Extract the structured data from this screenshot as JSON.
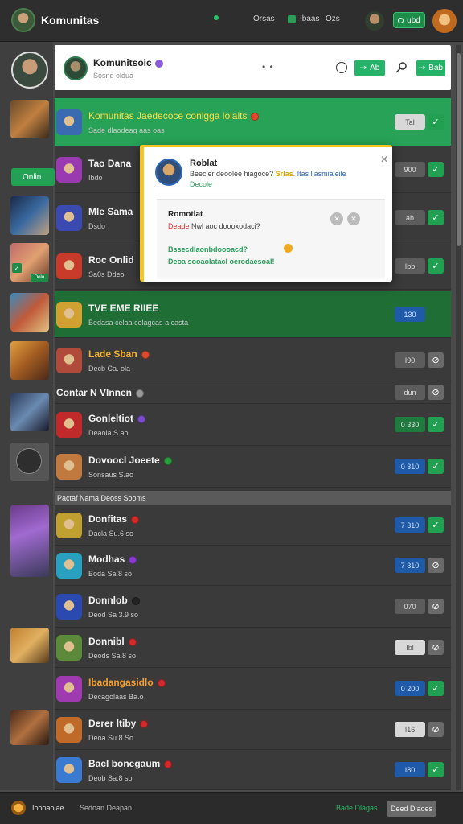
{
  "topbar": {
    "title": "Komunitas",
    "link1": "Orsas",
    "link2": "Ibaas",
    "link3": "Ozs",
    "pill_label": "ubd"
  },
  "rail": {
    "online_label": "Onlin",
    "badge1": "✓",
    "badge2": "Dolo"
  },
  "chat_header": {
    "name": "Komunitsoic",
    "subtitle": "Sosnd oldua",
    "btn1_label": "Ab",
    "btn2_label": "Bab"
  },
  "rows": [
    {
      "title": "Komunitas Jaedecoce conlgga lolalts",
      "subtitle": "Sade dlaodeag aas oas",
      "count": "Tal",
      "check_color": "green",
      "count_style": "light",
      "highlight": "green",
      "dot": "#e04a2a",
      "icon_color": "#3a6ab0"
    },
    {
      "title": "Tao Dana",
      "subtitle": "Ibdo",
      "count": "900",
      "check_color": "green",
      "count_style": "gray",
      "highlight": "",
      "dot": "",
      "icon_color": "#9a3ab0"
    },
    {
      "title": "Mle Sama",
      "subtitle": "Dsdo",
      "count": "ab",
      "check_color": "green",
      "count_style": "gray",
      "highlight": "",
      "dot": "",
      "icon_color": "#3a4ab0"
    },
    {
      "title": "Roc Onlid",
      "subtitle": "Sa0s Ddeo",
      "count": "Ibb",
      "check_color": "green",
      "count_style": "gray",
      "highlight": "",
      "dot": "",
      "icon_color": "#c83a2a"
    },
    {
      "title": "TVE EME RIIEE",
      "subtitle": "Bedasa celaa celagcas a casta",
      "count": "130",
      "check_color": "",
      "count_style": "blue",
      "highlight": "darkgreen",
      "dot": "",
      "icon_color": "#d0a030"
    },
    {
      "title": "Lade Sban",
      "subtitle": "Decb Ca. ola",
      "count": "I90",
      "check_color": "gray",
      "count_style": "gray",
      "highlight": "",
      "dot": "#e04a2a",
      "icon_color": "#b04a3a",
      "title_color": "#f0b030"
    },
    {
      "title": "Contar N Vlnnen",
      "subtitle": "",
      "count": "dun",
      "check_color": "gray",
      "count_style": "gray",
      "highlight": "",
      "dot": "#999",
      "icon_color": ""
    },
    {
      "title": "Gonleltiot",
      "subtitle": "Deaola S.ao",
      "count": "0 330",
      "check_color": "green",
      "count_style": "green",
      "highlight": "",
      "dot": "#7a4ad0",
      "icon_color": "#c02a2a"
    },
    {
      "title": "Dovoocl Joeete",
      "subtitle": "Sonsaus S.ao",
      "count": "0 310",
      "check_color": "green",
      "count_style": "blue",
      "highlight": "",
      "dot": "#2aa040",
      "icon_color": "#c07a40"
    },
    {
      "title": "Donfitas",
      "subtitle": "Dacla Su.6 so",
      "count": "7 310",
      "check_color": "green",
      "count_style": "blue",
      "highlight": "",
      "dot": "#d02a2a",
      "icon_color": "#c0a030"
    },
    {
      "title": "Modhas",
      "subtitle": "Boda Sa.8 so",
      "count": "7 310",
      "check_color": "gray",
      "count_style": "blue",
      "highlight": "",
      "dot": "#8a3ad0",
      "icon_color": "#2aa0c0"
    },
    {
      "title": "Donnlob",
      "subtitle": "Deod Sa 3.9 so",
      "count": "070",
      "check_color": "gray",
      "count_style": "gray",
      "highlight": "",
      "dot": "#222",
      "icon_color": "#2a4ab0"
    },
    {
      "title": "Donnibl",
      "subtitle": "Deods Sa.8 so",
      "count": "Ibl",
      "check_color": "gray",
      "count_style": "light",
      "highlight": "",
      "dot": "#d02a2a",
      "icon_color": "#5a8a3a"
    },
    {
      "title": "Ibadangasidlo",
      "subtitle": "Decagolaas Ba.o",
      "count": "0 200",
      "check_color": "green",
      "count_style": "blue",
      "highlight": "",
      "dot": "#d02a2a",
      "icon_color": "#a03ab0",
      "title_color": "#f0a030"
    },
    {
      "title": "Derer ltiby",
      "subtitle": "Deoa Su.8 So",
      "count": "I16",
      "check_color": "gray",
      "count_style": "light",
      "highlight": "",
      "dot": "#d02a2a",
      "icon_color": "#c06a2a"
    },
    {
      "title": "Bacl bonegaum",
      "subtitle": "Deob Sa.8 so",
      "count": "I80",
      "check_color": "green",
      "count_style": "blue",
      "highlight": "",
      "dot": "#d02a2a",
      "icon_color": "#3a7ad0"
    }
  ],
  "section_label": "Pactaf Nama  Deoss Sooms",
  "popup": {
    "name": "Roblat",
    "message_a": "Beecier deoolee hiagoce? ",
    "message_y": "Srlas.",
    "message_b": " Itas llasmialeile",
    "message2": "Decole",
    "inner_title": "Romotlat",
    "inner_sub_a": "Deade ",
    "inner_sub_b": "Nwl aoc doooxodaci?",
    "green1": "Bssecdlaonbdoooacd?",
    "green2": "Deoa sooaolatacl oerodaesoal!"
  },
  "bottombar": {
    "text1": "Ioooaoiae",
    "text2": "Sedoan Deapan",
    "text3": "Bade Dlagas",
    "button": "Deed Dlaoes"
  }
}
